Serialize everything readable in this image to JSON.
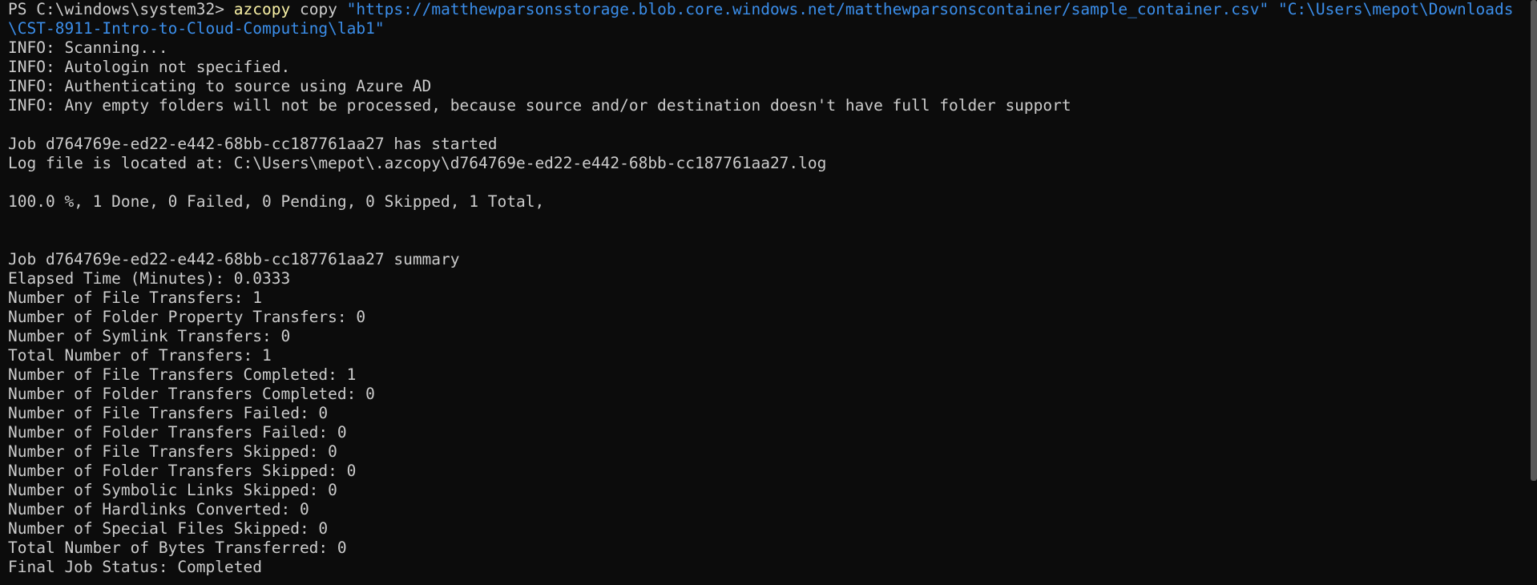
{
  "terminal": {
    "prompt": "PS C:\\windows\\system32> ",
    "command": "azcopy",
    "subcommand": " copy ",
    "source": "\"https://matthewparsonsstorage.blob.core.windows.net/matthewparsonscontainer/sample_container.csv\"",
    "space": " ",
    "destination": "\"C:\\Users\\mepot\\Downloads\\CST-8911-Intro-to-Cloud-Computing\\lab1\"",
    "info_lines": [
      "INFO: Scanning...",
      "INFO: Autologin not specified.",
      "INFO: Authenticating to source using Azure AD",
      "INFO: Any empty folders will not be processed, because source and/or destination doesn't have full folder support"
    ],
    "job_started": "Job d764769e-ed22-e442-68bb-cc187761aa27 has started",
    "log_file": "Log file is located at: C:\\Users\\mepot\\.azcopy\\d764769e-ed22-e442-68bb-cc187761aa27.log",
    "progress": "100.0 %, 1 Done, 0 Failed, 0 Pending, 0 Skipped, 1 Total,",
    "summary_title": "Job d764769e-ed22-e442-68bb-cc187761aa27 summary",
    "summary_lines": [
      "Elapsed Time (Minutes): 0.0333",
      "Number of File Transfers: 1",
      "Number of Folder Property Transfers: 0",
      "Number of Symlink Transfers: 0",
      "Total Number of Transfers: 1",
      "Number of File Transfers Completed: 1",
      "Number of Folder Transfers Completed: 0",
      "Number of File Transfers Failed: 0",
      "Number of Folder Transfers Failed: 0",
      "Number of File Transfers Skipped: 0",
      "Number of Folder Transfers Skipped: 0",
      "Number of Symbolic Links Skipped: 0",
      "Number of Hardlinks Converted: 0",
      "Number of Special Files Skipped: 0",
      "Total Number of Bytes Transferred: 0",
      "Final Job Status: Completed"
    ]
  },
  "colors": {
    "background": "#0c0c0c",
    "text": "#cccccc",
    "command": "#f9f1a5",
    "string": "#3b8eea"
  }
}
